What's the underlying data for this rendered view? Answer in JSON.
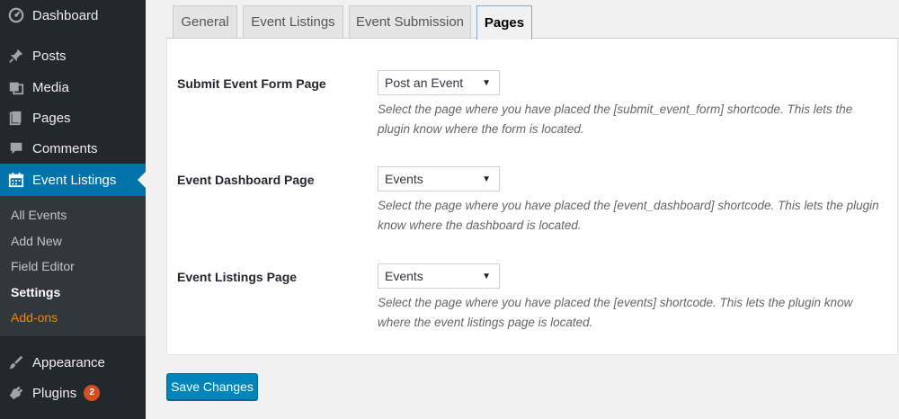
{
  "sidebar": {
    "items": [
      {
        "label": "Dashboard",
        "icon": "dashboard-icon"
      },
      {
        "label": "Posts",
        "icon": "pin-icon"
      },
      {
        "label": "Media",
        "icon": "media-icon"
      },
      {
        "label": "Pages",
        "icon": "pages-icon"
      },
      {
        "label": "Comments",
        "icon": "comments-icon"
      },
      {
        "label": "Event Listings",
        "icon": "calendar-icon"
      },
      {
        "label": "Appearance",
        "icon": "brush-icon"
      },
      {
        "label": "Plugins",
        "icon": "plugin-icon",
        "badge": "2"
      }
    ],
    "submenu": [
      "All Events",
      "Add New",
      "Field Editor",
      "Settings",
      "Add-ons"
    ],
    "active_color": "#0073aa",
    "addon_color": "#f18500"
  },
  "tabs": [
    "General",
    "Event Listings",
    "Event Submission",
    "Pages"
  ],
  "active_tab": "Pages",
  "rows": [
    {
      "label": "Submit Event Form Page",
      "selected": "Post an Event",
      "description": "Select the page where you have placed the [submit_event_form] shortcode. This lets the plugin know where the form is located."
    },
    {
      "label": "Event Dashboard Page",
      "selected": "Events",
      "description": "Select the page where you have placed the [event_dashboard] shortcode. This lets the plugin know where the dashboard is located."
    },
    {
      "label": "Event Listings Page",
      "selected": "Events",
      "description": "Select the page where you have placed the [events] shortcode. This lets the plugin know where the event listings page is located."
    }
  ],
  "save_label": "Save Changes",
  "button_color": "#0085ba"
}
